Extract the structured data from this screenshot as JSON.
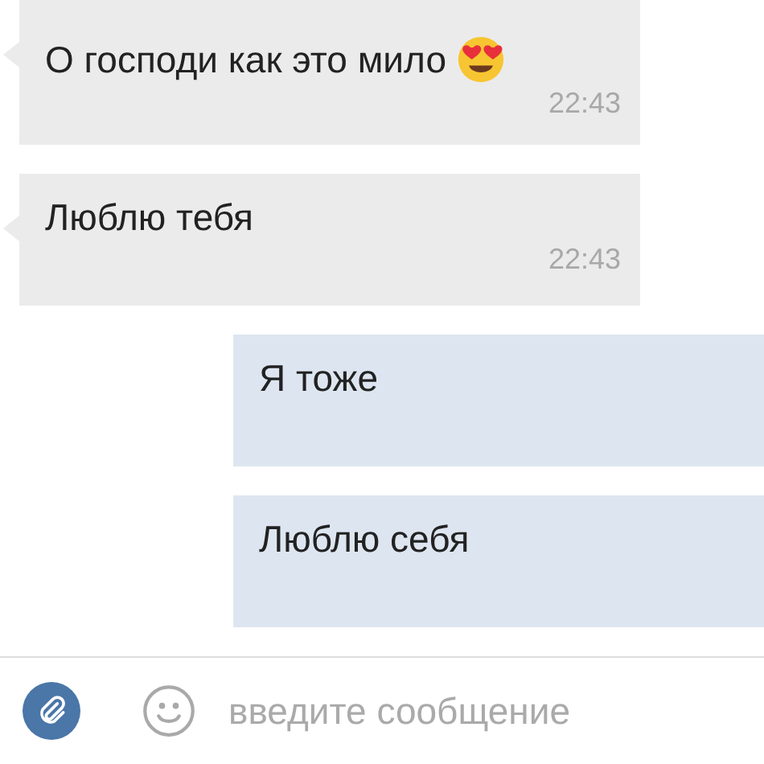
{
  "messages": [
    {
      "kind": "incoming",
      "text": "О господи как это мило",
      "emoji": true,
      "time": "22:43"
    },
    {
      "kind": "incoming",
      "text": "Люблю тебя",
      "emoji": false,
      "time": "22:43"
    },
    {
      "kind": "outgoing",
      "text": "Я тоже",
      "emoji": false
    },
    {
      "kind": "outgoing",
      "text": "Люблю себя",
      "emoji": false
    }
  ],
  "composer": {
    "placeholder": "введите сообщение"
  }
}
